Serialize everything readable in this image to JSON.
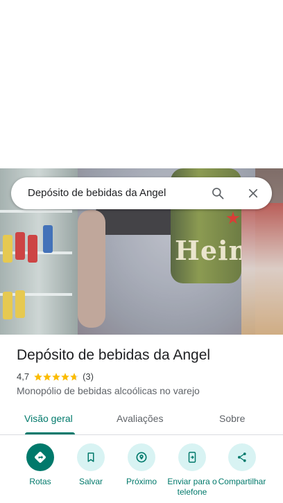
{
  "search": {
    "query": "Depósito de bebidas da Angel"
  },
  "photo": {
    "bottle_text": "Hein"
  },
  "place": {
    "name": "Depósito de bebidas da Angel",
    "rating": "4,7",
    "stars": 4.7,
    "review_count": "(3)",
    "category": "Monopólio de bebidas alcoólicas no varejo"
  },
  "tabs": [
    {
      "label": "Visão geral",
      "active": true
    },
    {
      "label": "Avaliações",
      "active": false
    },
    {
      "label": "Sobre",
      "active": false
    }
  ],
  "actions": [
    {
      "label": "Rotas",
      "icon": "directions-icon"
    },
    {
      "label": "Salvar",
      "icon": "bookmark-icon"
    },
    {
      "label": "Próximo",
      "icon": "nearby-icon"
    },
    {
      "label": "Enviar para o telefone",
      "icon": "send-to-phone-icon"
    },
    {
      "label": "Compartilhar",
      "icon": "share-icon"
    }
  ],
  "colors": {
    "accent": "#00796b",
    "action_bg": "#d8f3f3",
    "star": "#fbbc04"
  }
}
